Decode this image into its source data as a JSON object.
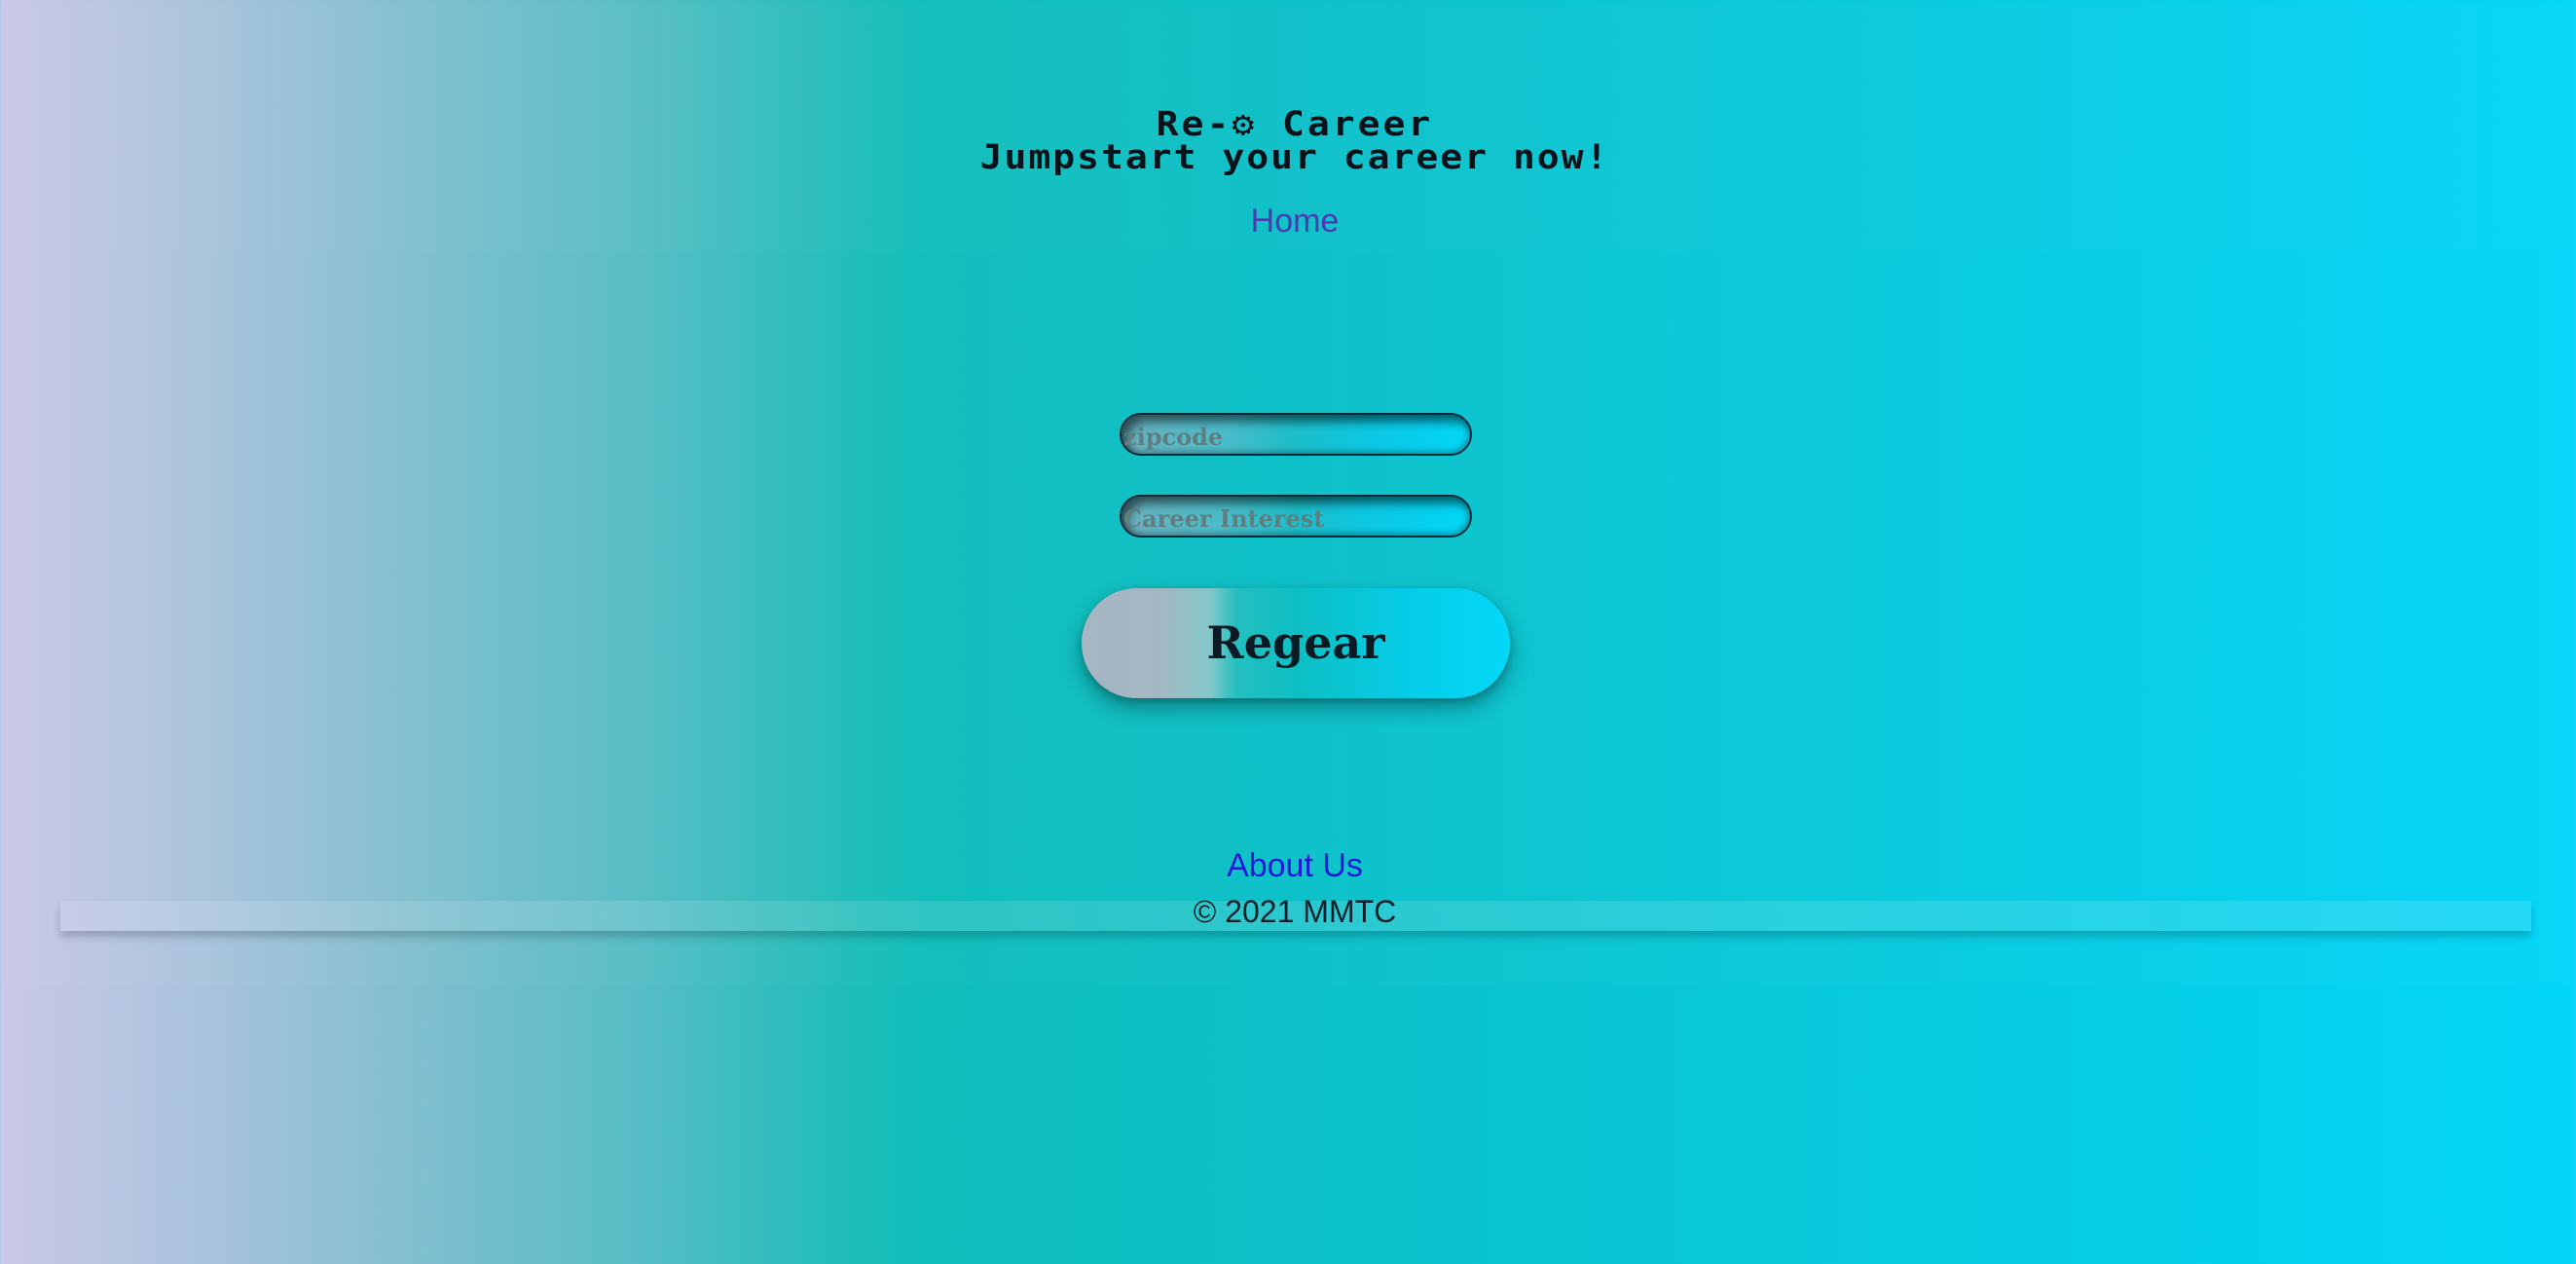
{
  "header": {
    "title": "Re-⚙ Career",
    "tagline": "Jumpstart your career now!",
    "nav_home": "Home"
  },
  "form": {
    "zipcode_placeholder": "zipcode",
    "career_placeholder": "Career Interest",
    "submit_label": "Regear"
  },
  "footer": {
    "about_label": "About Us",
    "copyright": "© 2021 MMTC"
  }
}
